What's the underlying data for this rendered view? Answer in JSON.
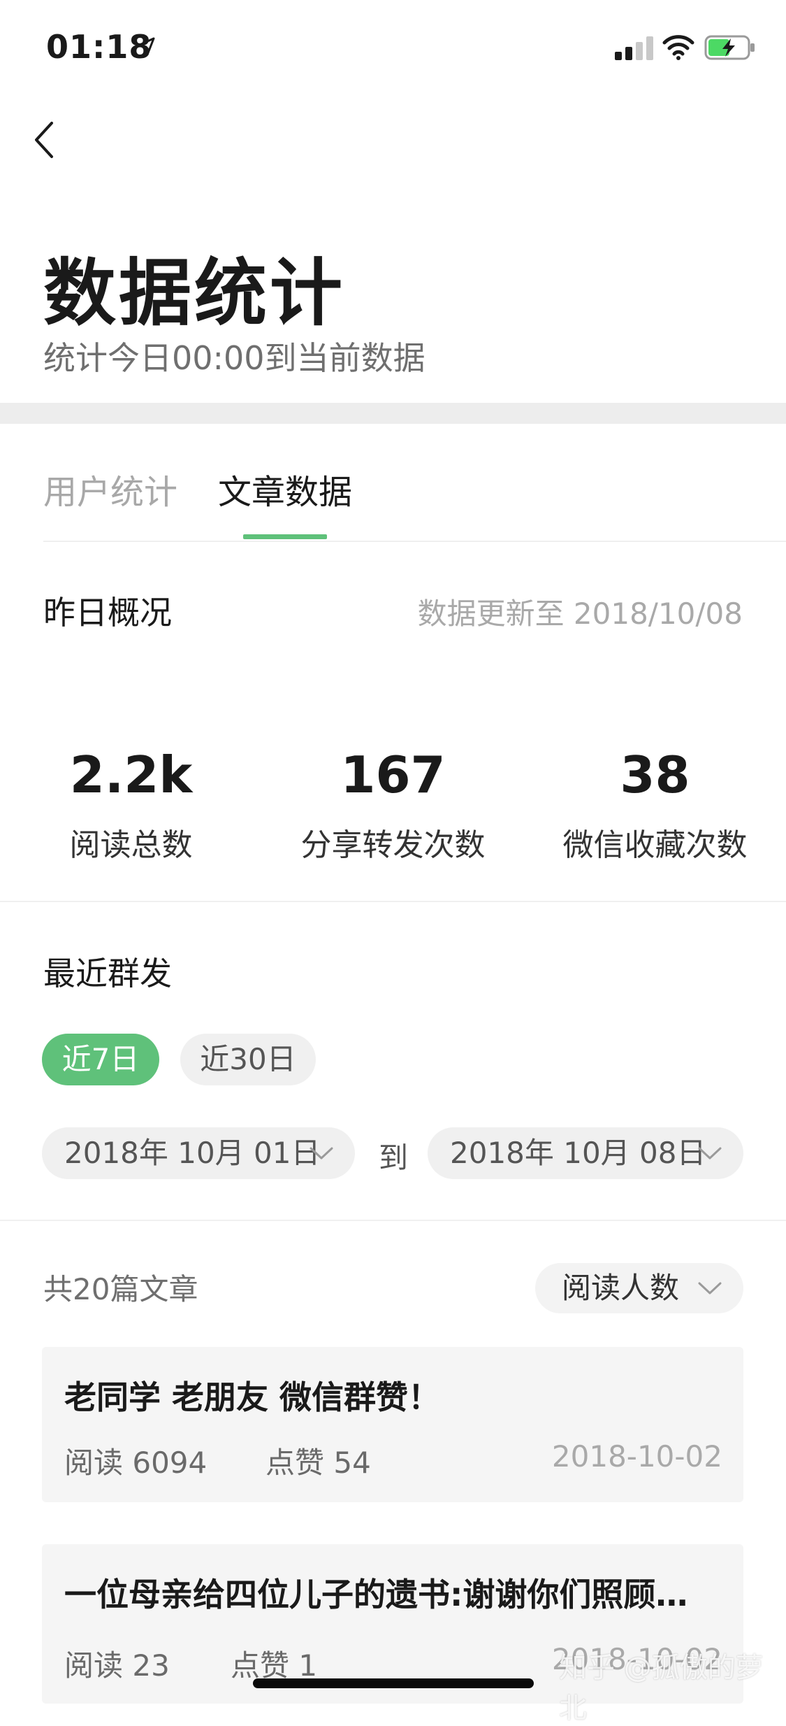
{
  "status_bar": {
    "time": "01:18"
  },
  "header": {
    "title": "数据统计",
    "subtitle": "统计今日00:00到当前数据"
  },
  "tabs": [
    {
      "label": "用户统计",
      "active": false
    },
    {
      "label": "文章数据",
      "active": true
    }
  ],
  "overview": {
    "label": "昨日概况",
    "updated": "数据更新至 2018/10/08",
    "metrics": [
      {
        "value": "2.2k",
        "label": "阅读总数"
      },
      {
        "value": "167",
        "label": "分享转发次数"
      },
      {
        "value": "38",
        "label": "微信收藏次数"
      }
    ]
  },
  "recent": {
    "title": "最近群发",
    "range_options": [
      "近7日",
      "近30日"
    ],
    "selected_range": "近7日",
    "date_from": "2018年 10月 01日",
    "date_to": "2018年 10月 08日",
    "to_label": "到",
    "article_count": "共20篇文章",
    "sort_label": "阅读人数"
  },
  "articles": [
    {
      "title": "老同学 老朋友 微信群赞！",
      "reads": "阅读 6094",
      "likes": "点赞 54",
      "date": "2018-10-02"
    },
    {
      "title": "一位母亲给四位儿子的遗书:谢谢你们照顾…",
      "reads": "阅读 23",
      "likes": "点赞 1",
      "date": "2018-10-02"
    }
  ],
  "watermark": "知乎 @孤傲的萝北",
  "colors": {
    "accent": "#5fc17a",
    "muted": "#a9a9a9"
  }
}
